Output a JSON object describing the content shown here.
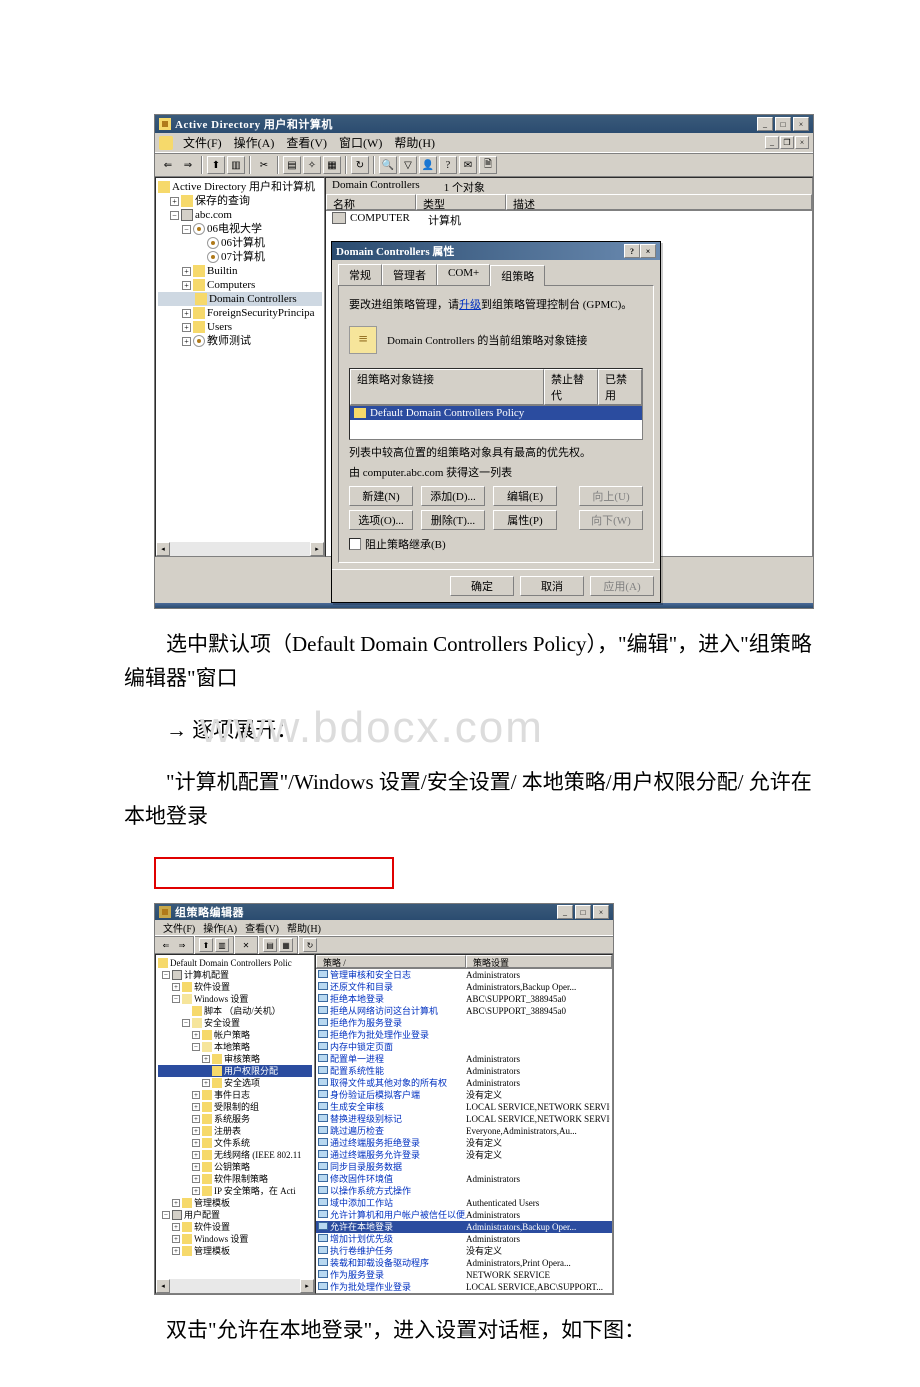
{
  "ss1": {
    "title": "Active Directory 用户和计算机",
    "menus": [
      "文件(F)",
      "操作(A)",
      "查看(V)",
      "窗口(W)",
      "帮助(H)"
    ],
    "tree_root": "Active Directory 用户和计算机",
    "tree": [
      {
        "t": "保存的查询",
        "i": "fld",
        "tw": "+",
        "ind": 1
      },
      {
        "t": "abc.com",
        "i": "srv",
        "tw": "−",
        "ind": 1
      },
      {
        "t": "06电视大学",
        "i": "ou",
        "tw": "−",
        "ind": 2
      },
      {
        "t": "06计算机",
        "i": "ou",
        "tw": "",
        "ind": 3
      },
      {
        "t": "07计算机",
        "i": "ou",
        "tw": "",
        "ind": 3
      },
      {
        "t": "Builtin",
        "i": "fld",
        "tw": "+",
        "ind": 2
      },
      {
        "t": "Computers",
        "i": "fld",
        "tw": "+",
        "ind": 2
      },
      {
        "t": "Domain Controllers",
        "i": "fld",
        "tw": "",
        "ind": 2,
        "sel": true
      },
      {
        "t": "ForeignSecurityPrincipa",
        "i": "fld",
        "tw": "+",
        "ind": 2
      },
      {
        "t": "Users",
        "i": "fld",
        "tw": "+",
        "ind": 2
      },
      {
        "t": "教师测试",
        "i": "ou",
        "tw": "+",
        "ind": 2
      }
    ],
    "path_label": "Domain Controllers",
    "path_count": "1 个对象",
    "cols": {
      "c1": "名称",
      "c2": "类型",
      "c3": "描述"
    },
    "row": {
      "name": "COMPUTER",
      "type": "计算机"
    },
    "dlg": {
      "title": "Domain Controllers 属性",
      "tabs": [
        "常规",
        "管理者",
        "COM+",
        "组策略"
      ],
      "hint_pre": "要改进组策略管理，请",
      "hint_link": "升级",
      "hint_post": "到组策略管理控制台 (GPMC)。",
      "linkline": "Domain Controllers 的当前组策略对象链接",
      "gp_cols": {
        "c1": "组策略对象链接",
        "c2": "禁止替代",
        "c3": "已禁用"
      },
      "gp_item": "Default Domain Controllers Policy",
      "note1": "列表中较高位置的组策略对象具有最高的优先权。",
      "note2": "由 computer.abc.com 获得这一列表",
      "btns1": [
        "新建(N)",
        "添加(D)...",
        "编辑(E)",
        "向上(U)"
      ],
      "btns2": [
        "选项(O)...",
        "删除(T)...",
        "属性(P)",
        "向下(W)"
      ],
      "chk": "阻止策略继承(B)",
      "foot": [
        "确定",
        "取消",
        "应用(A)"
      ]
    }
  },
  "text": {
    "p1": "选中默认项（Default Domain Controllers Policy），\"编辑\"，进入\"组策略编辑器\"窗口",
    "p2": "→ 逐项展开：",
    "wm": "www.bdocx.com",
    "p3": "\"计算机配置\"/Windows 设置/安全设置/ 本地策略/用户权限分配/ 允许在本地登录",
    "p4": "双击\"允许在本地登录\"，进入设置对话框，如下图："
  },
  "ss2": {
    "title": "组策略编辑器",
    "menus": [
      "文件(F)",
      "操作(A)",
      "查看(V)",
      "帮助(H)"
    ],
    "root": "Default Domain Controllers Polic",
    "tree": [
      {
        "t": "计算机配置",
        "i": "srv",
        "tw": "−",
        "ind": 0
      },
      {
        "t": "软件设置",
        "i": "fld",
        "tw": "+",
        "ind": 1
      },
      {
        "t": "Windows 设置",
        "i": "fld-o",
        "tw": "−",
        "ind": 1
      },
      {
        "t": "脚本 （启动/关机）",
        "i": "fld",
        "tw": "",
        "ind": 2
      },
      {
        "t": "安全设置",
        "i": "fld-o",
        "tw": "−",
        "ind": 2
      },
      {
        "t": "帐户策略",
        "i": "fld",
        "tw": "+",
        "ind": 3
      },
      {
        "t": "本地策略",
        "i": "fld-o",
        "tw": "−",
        "ind": 3
      },
      {
        "t": "审核策略",
        "i": "fld",
        "tw": "+",
        "ind": 4
      },
      {
        "t": "用户权限分配",
        "i": "fld",
        "tw": "",
        "ind": 4,
        "sel": true
      },
      {
        "t": "安全选项",
        "i": "fld",
        "tw": "+",
        "ind": 4
      },
      {
        "t": "事件日志",
        "i": "fld",
        "tw": "+",
        "ind": 3
      },
      {
        "t": "受限制的组",
        "i": "fld",
        "tw": "+",
        "ind": 3
      },
      {
        "t": "系统服务",
        "i": "fld",
        "tw": "+",
        "ind": 3
      },
      {
        "t": "注册表",
        "i": "fld",
        "tw": "+",
        "ind": 3
      },
      {
        "t": "文件系统",
        "i": "fld",
        "tw": "+",
        "ind": 3
      },
      {
        "t": "无线网络 (IEEE 802.11",
        "i": "fld",
        "tw": "+",
        "ind": 3
      },
      {
        "t": "公钥策略",
        "i": "fld",
        "tw": "+",
        "ind": 3
      },
      {
        "t": "软件限制策略",
        "i": "fld",
        "tw": "+",
        "ind": 3
      },
      {
        "t": "IP 安全策略，在 Acti",
        "i": "fld",
        "tw": "+",
        "ind": 3
      },
      {
        "t": "管理模板",
        "i": "fld",
        "tw": "+",
        "ind": 1
      },
      {
        "t": "用户配置",
        "i": "srv",
        "tw": "−",
        "ind": 0
      },
      {
        "t": "软件设置",
        "i": "fld",
        "tw": "+",
        "ind": 1
      },
      {
        "t": "Windows 设置",
        "i": "fld",
        "tw": "+",
        "ind": 1
      },
      {
        "t": "管理模板",
        "i": "fld",
        "tw": "+",
        "ind": 1
      }
    ],
    "cols": {
      "c1": "策略 /",
      "c2": "策略设置"
    },
    "rows": [
      {
        "p": "管理审核和安全日志",
        "s": "Administrators"
      },
      {
        "p": "还原文件和目录",
        "s": "Administrators,Backup Oper..."
      },
      {
        "p": "拒绝本地登录",
        "s": "ABC\\SUPPORT_388945a0"
      },
      {
        "p": "拒绝从网络访问这台计算机",
        "s": "ABC\\SUPPORT_388945a0"
      },
      {
        "p": "拒绝作为服务登录",
        "s": ""
      },
      {
        "p": "拒绝作为批处理作业登录",
        "s": ""
      },
      {
        "p": "内存中锁定页面",
        "s": ""
      },
      {
        "p": "配置单一进程",
        "s": "Administrators"
      },
      {
        "p": "配置系统性能",
        "s": "Administrators"
      },
      {
        "p": "取得文件或其他对象的所有权",
        "s": "Administrators"
      },
      {
        "p": "身份验证后模拟客户端",
        "s": "没有定义"
      },
      {
        "p": "生成安全审核",
        "s": "LOCAL SERVICE,NETWORK SERVICE"
      },
      {
        "p": "替换进程级别标记",
        "s": "LOCAL SERVICE,NETWORK SERVICE"
      },
      {
        "p": "跳过遍历检查",
        "s": "Everyone,Administrators,Au..."
      },
      {
        "p": "通过终端服务拒绝登录",
        "s": "没有定义"
      },
      {
        "p": "通过终端服务允许登录",
        "s": "没有定义"
      },
      {
        "p": "同步目录服务数据",
        "s": ""
      },
      {
        "p": "修改固件环境值",
        "s": "Administrators"
      },
      {
        "p": "以操作系统方式操作",
        "s": ""
      },
      {
        "p": "域中添加工作站",
        "s": "Authenticated Users"
      },
      {
        "p": "允许计算机和用户帐户被信任以便用于...",
        "s": "Administrators"
      },
      {
        "p": "允许在本地登录",
        "s": "Administrators,Backup Oper...",
        "hl": true
      },
      {
        "p": "增加计划优先级",
        "s": "Administrators"
      },
      {
        "p": "执行卷维护任务",
        "s": "没有定义"
      },
      {
        "p": "装载和卸载设备驱动程序",
        "s": "Administrators,Print Opera..."
      },
      {
        "p": "作为服务登录",
        "s": "NETWORK SERVICE"
      },
      {
        "p": "作为批处理作业登录",
        "s": "LOCAL SERVICE,ABC\\SUPPORT..."
      }
    ]
  }
}
